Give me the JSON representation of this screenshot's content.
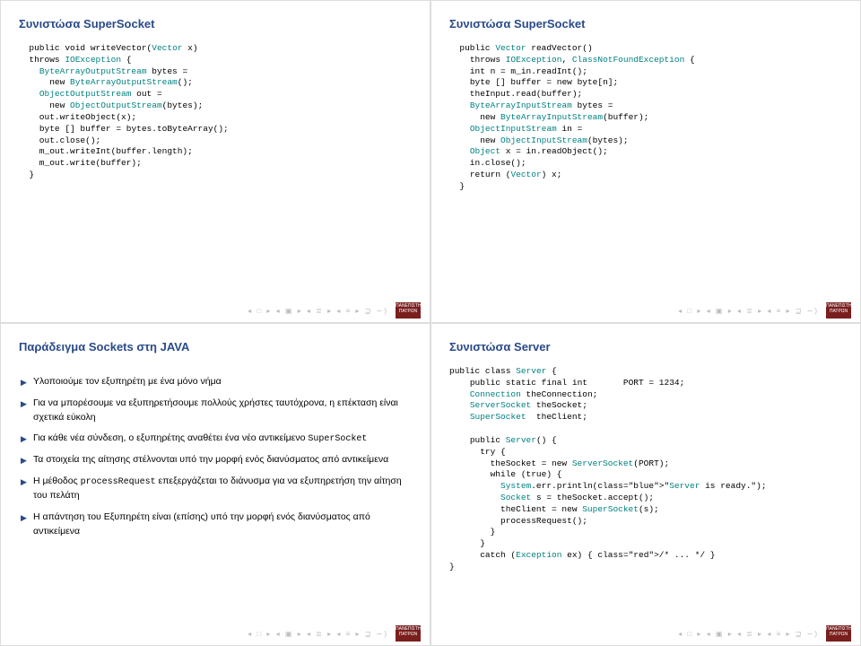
{
  "slides": {
    "tl": {
      "title": "Συνιστώσα SuperSocket",
      "code": "  public void writeVector(Vector x)\n  throws IOException {\n    ByteArrayOutputStream bytes =\n      new ByteArrayOutputStream();\n    ObjectOutputStream out =\n      new ObjectOutputStream(bytes);\n    out.writeObject(x);\n    byte [] buffer = bytes.toByteArray();\n    out.close();\n    m_out.writeInt(buffer.length);\n    m_out.write(buffer);\n  }"
    },
    "tr": {
      "title": "Συνιστώσα SuperSocket",
      "code": "  public Vector readVector()\n    throws IOException, ClassNotFoundException {\n    int n = m_in.readInt();\n    byte [] buffer = new byte[n];\n    theInput.read(buffer);\n    ByteArrayInputStream bytes =\n      new ByteArrayInputStream(buffer);\n    ObjectInputStream in =\n      new ObjectInputStream(bytes);\n    Object x = in.readObject();\n    in.close();\n    return (Vector) x;\n  }"
    },
    "bl": {
      "title": "Παράδειγμα Sockets στη JAVA",
      "items": [
        "Υλοποιούμε τον εξυπηρέτη με ένα μόνο νήμα",
        "Για να μπορέσουμε να εξυπηρετήσουμε πολλούς χρήστες ταυτόχρονα, η επέκταση είναι σχετικά εύκολη",
        "Για κάθε νέα σύνδεση, ο εξυπηρέτης αναθέτει ένα νέο αντικείμενο |SuperSocket|",
        "Τα στοιχεία της αίτησης στέλνονται υπό την μορφή ενός διανύσματος από αντικείμενα",
        "Η μέθοδος |processRequest| επεξεργάζεται το διάνυσμα για να εξυπηρετήση την αίτηση του πελάτη",
        "Η απάντηση του Εξυπηρέτη είναι (επίσης) υπό την μορφή ενός διανύσματος από αντικείμενα"
      ]
    },
    "br": {
      "title": "Συνιστώσα Server",
      "code": "public class Server {\n    public static final int       PORT = 1234;\n    Connection theConnection;\n    ServerSocket theSocket;\n    SuperSocket  theClient;\n\n    public Server() {\n      try {\n        theSocket = new ServerSocket(PORT);\n        while (true) {\n          System.err.println(\"Server is ready.\");\n          Socket s = theSocket.accept();\n          theClient = new SuperSocket(s);\n          processRequest();\n        }\n      }\n      catch (Exception ex) { /* ... */ }\n}"
    }
  },
  "nav": "◂ □ ▸ ◂ ▣ ▸ ◂ ≣ ▸ ◂ ≡ ▸  ⊒  ∽)",
  "logo_text": "ΠΑΝΕΠΙΣΤΗΜΙΟ\nΠΑΤΡΩΝ"
}
